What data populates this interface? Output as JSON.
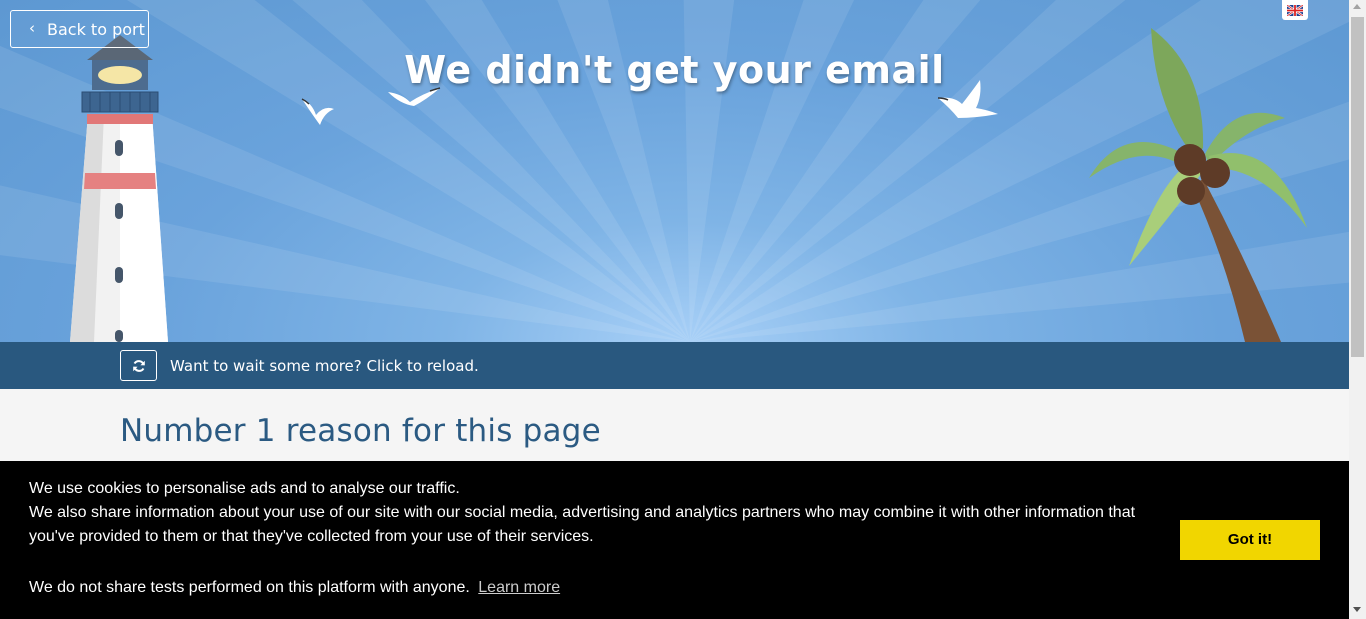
{
  "header": {
    "back_label": "Back to port",
    "back_icon": "chevron-left-icon",
    "language_icon": "uk-flag-icon",
    "title": "We didn't get your email"
  },
  "reload_bar": {
    "icon": "refresh-icon",
    "text": "Want to wait some more? Click to reload."
  },
  "content": {
    "heading": "Number 1 reason for this page"
  },
  "cookie_banner": {
    "line1": "We use cookies to personalise ads and to analyse our traffic.",
    "line2": "We also share information about your use of our site with our social media, advertising and analytics partners who may combine it with other information that you've provided to them or that they've collected from your use of their services.",
    "line3": "We do not share tests performed on this platform with anyone.",
    "learn_more": "Learn more",
    "accept_label": "Got it!"
  },
  "colors": {
    "reload_bar": "#29587f",
    "heading": "#2b5a82",
    "accept_button": "#f1d600",
    "banner_bg": "#000000"
  }
}
